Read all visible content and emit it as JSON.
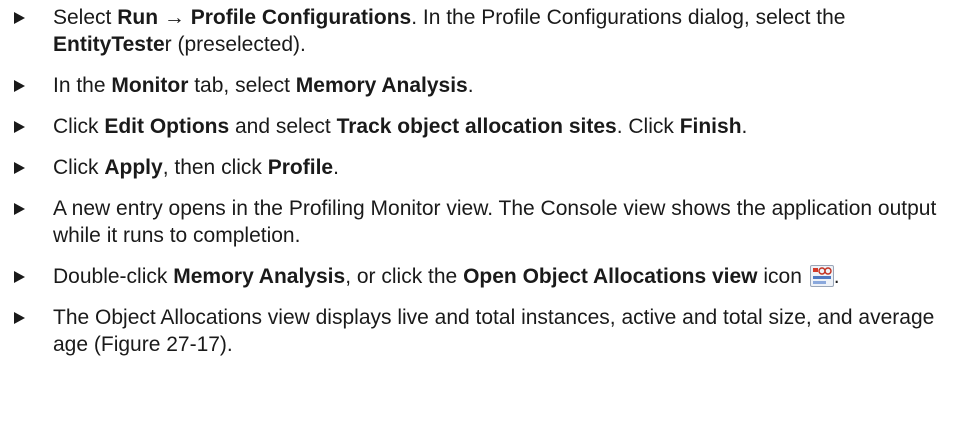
{
  "bullet_icon": "right-pointing-triangle-icon",
  "steps": [
    {
      "t1": "Select ",
      "b1": "Run",
      "t2": " → ",
      "b2": "Profile Configurations",
      "t3": ". In the Profile Configurations dialog, select the ",
      "b3": "EntityTeste",
      "t4": "r (preselected)."
    },
    {
      "t1": "In the ",
      "b1": "Monitor",
      "t2": " tab, select ",
      "b2": "Memory Analysis",
      "t3": "."
    },
    {
      "t1": "Click ",
      "b1": "Edit Options",
      "t2": " and select ",
      "b2": "Track object allocation sites",
      "t3": ". Click ",
      "b3": "Finish",
      "t4": "."
    },
    {
      "t1": "Click ",
      "b1": "Apply",
      "t2": ", then click ",
      "b2": "Profile",
      "t3": "."
    },
    {
      "t1": "A new entry opens in the Profiling Monitor view. The Console view shows the application output while it runs to completion."
    },
    {
      "t1": "Double-click ",
      "b1": "Memory Analysis",
      "t2": ", or click the ",
      "b2": "Open Object Allocations view",
      "t3": " icon ",
      "icon": "object-allocations-view-icon",
      "t4": "."
    },
    {
      "t1": "The Object Allocations view displays live and total instances, active and total size, and average age (Figure 27-17)."
    }
  ]
}
